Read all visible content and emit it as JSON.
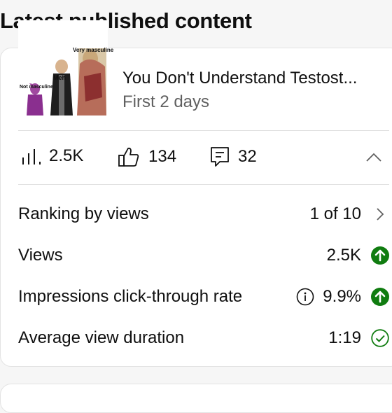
{
  "section_title": "Latest published content",
  "video": {
    "title": "You Don't Understand Testost...",
    "subtitle": "First 2 days",
    "thumbnail_labels": [
      "Very masculine",
      "Meh",
      "Not masculine"
    ]
  },
  "stats": {
    "views": "2.5K",
    "likes": "134",
    "comments": "32"
  },
  "metrics": [
    {
      "label": "Ranking by views",
      "value": "1 of 10",
      "trail_icon": "chevron-right-icon"
    },
    {
      "label": "Views",
      "value": "2.5K",
      "trail_icon": "green-up-arrow-icon"
    },
    {
      "label": "Impressions click-through rate",
      "value": "9.9%",
      "trail_icon": "green-up-arrow-icon"
    },
    {
      "label": "Average view duration",
      "value": "1:19",
      "trail_icon": "check-circle-icon"
    }
  ],
  "colors": {
    "positive": "#107c10",
    "muted": "#606060"
  }
}
